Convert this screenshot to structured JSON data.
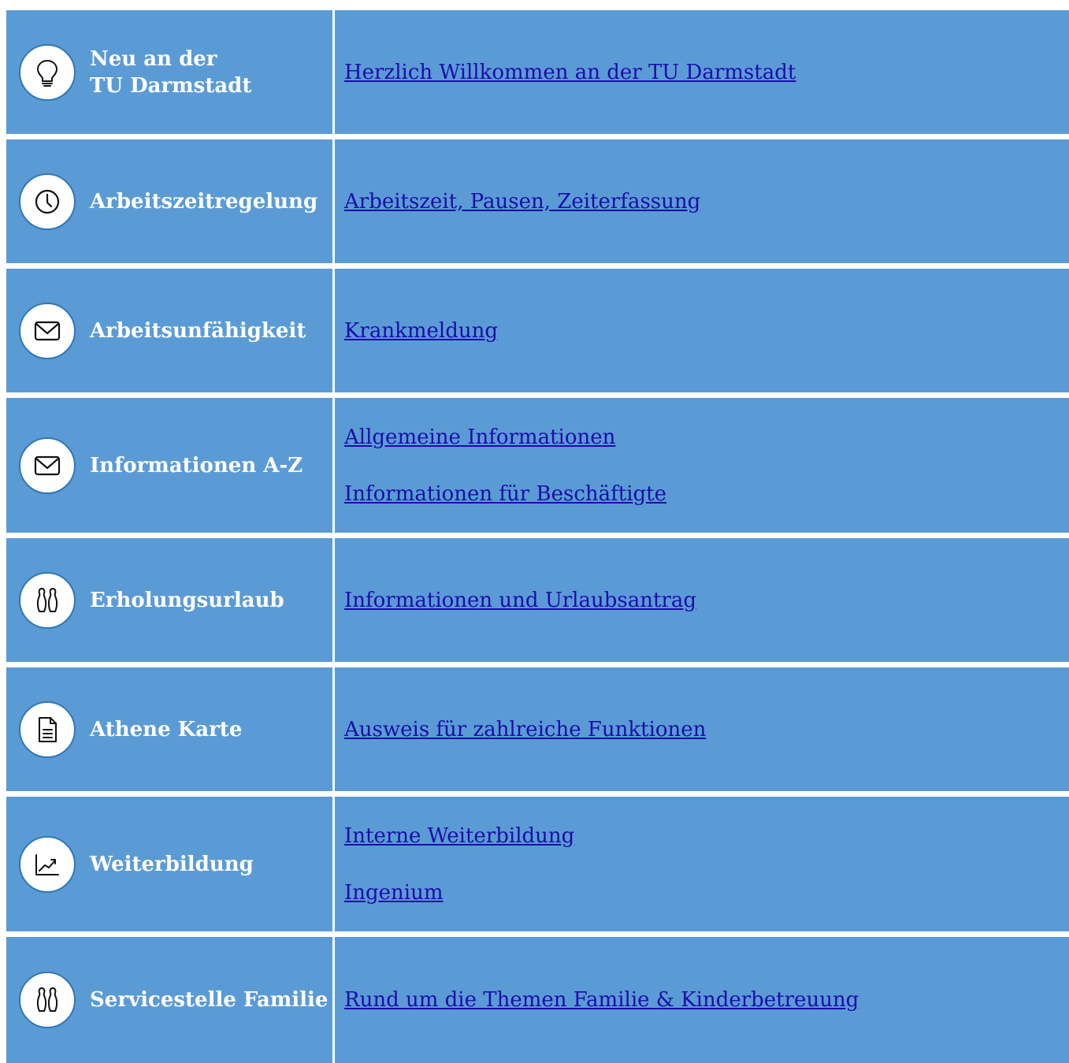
{
  "rows": [
    {
      "icon": "lightbulb-icon",
      "label_line1": "Neu an der",
      "label_line2": "TU Darmstadt",
      "links": [
        "Herzlich Willkommen an der TU Darmstadt"
      ]
    },
    {
      "icon": "clock-icon",
      "label_line1": "Arbeitszeitregelung",
      "links": [
        "Arbeitszeit, Pausen, Zeiterfassung"
      ]
    },
    {
      "icon": "envelope-icon",
      "label_line1": "Arbeitsunfähigkeit",
      "links": [
        "Krankmeldung"
      ]
    },
    {
      "icon": "envelope-icon",
      "label_line1": "Informationen A-Z",
      "links": [
        "Allgemeine Informationen",
        "Informationen für Beschäftigte"
      ]
    },
    {
      "icon": "bowling-pins-icon",
      "label_line1": "Erholungsurlaub",
      "links": [
        "Informationen und Urlaubsantrag"
      ]
    },
    {
      "icon": "document-icon",
      "label_line1": "Athene Karte",
      "links": [
        "Ausweis für zahlreiche Funktionen"
      ]
    },
    {
      "icon": "trend-chart-icon",
      "label_line1": "Weiterbildung",
      "links": [
        "Interne Weiterbildung",
        "Ingenium"
      ]
    },
    {
      "icon": "bowling-pins-icon",
      "label_line1": "Servicestelle Familie",
      "links": [
        "Rund um die Themen Familie & Kinderbetreuung"
      ]
    }
  ],
  "colors": {
    "cell_background": "#5b9bd5",
    "icon_border": "#2f77b8",
    "link": "#1a0dab",
    "label": "#ffffff"
  }
}
